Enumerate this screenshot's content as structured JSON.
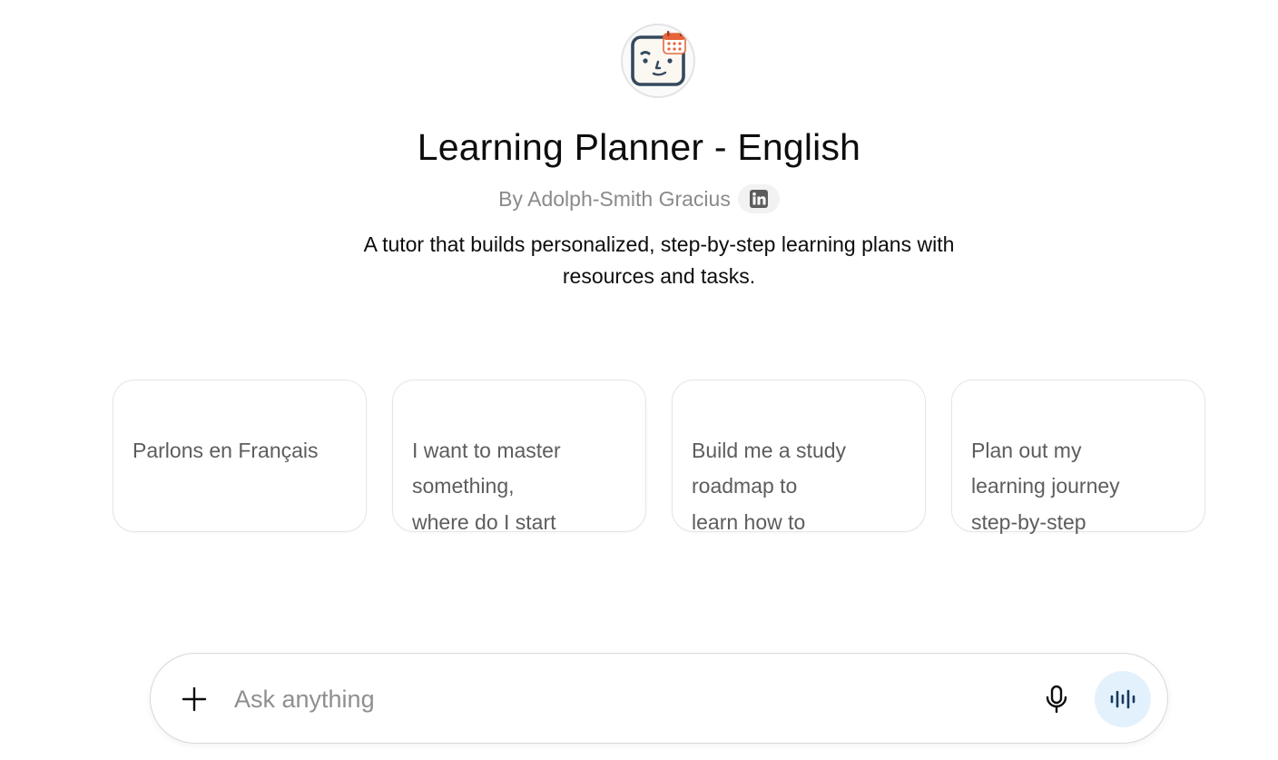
{
  "gpt": {
    "title": "Learning Planner - English",
    "author": "By Adolph-Smith Gracius",
    "description": "A tutor that builds personalized, step-by-step learning plans with resources and tasks.",
    "avatar_icon": "face-calendar-icon",
    "social_icon": "linkedin-icon"
  },
  "starters": [
    {
      "label": "Parlons en Français"
    },
    {
      "label": "I want to master\nsomething,\nwhere do I start"
    },
    {
      "label": "Build me a study\nroadmap to\nlearn how to"
    },
    {
      "label": "Plan out my\nlearning journey\nstep-by-step"
    }
  ],
  "composer": {
    "placeholder": "Ask anything",
    "value": "",
    "attach_icon": "plus-icon",
    "dictate_icon": "microphone-icon",
    "voice_icon": "voice-mode-icon"
  },
  "colors": {
    "muted_text": "#8a8a8a",
    "card_text": "#5d5d5d",
    "voice_button_bg": "#e3f1fc",
    "voice_icon": "#1a3a5c"
  }
}
